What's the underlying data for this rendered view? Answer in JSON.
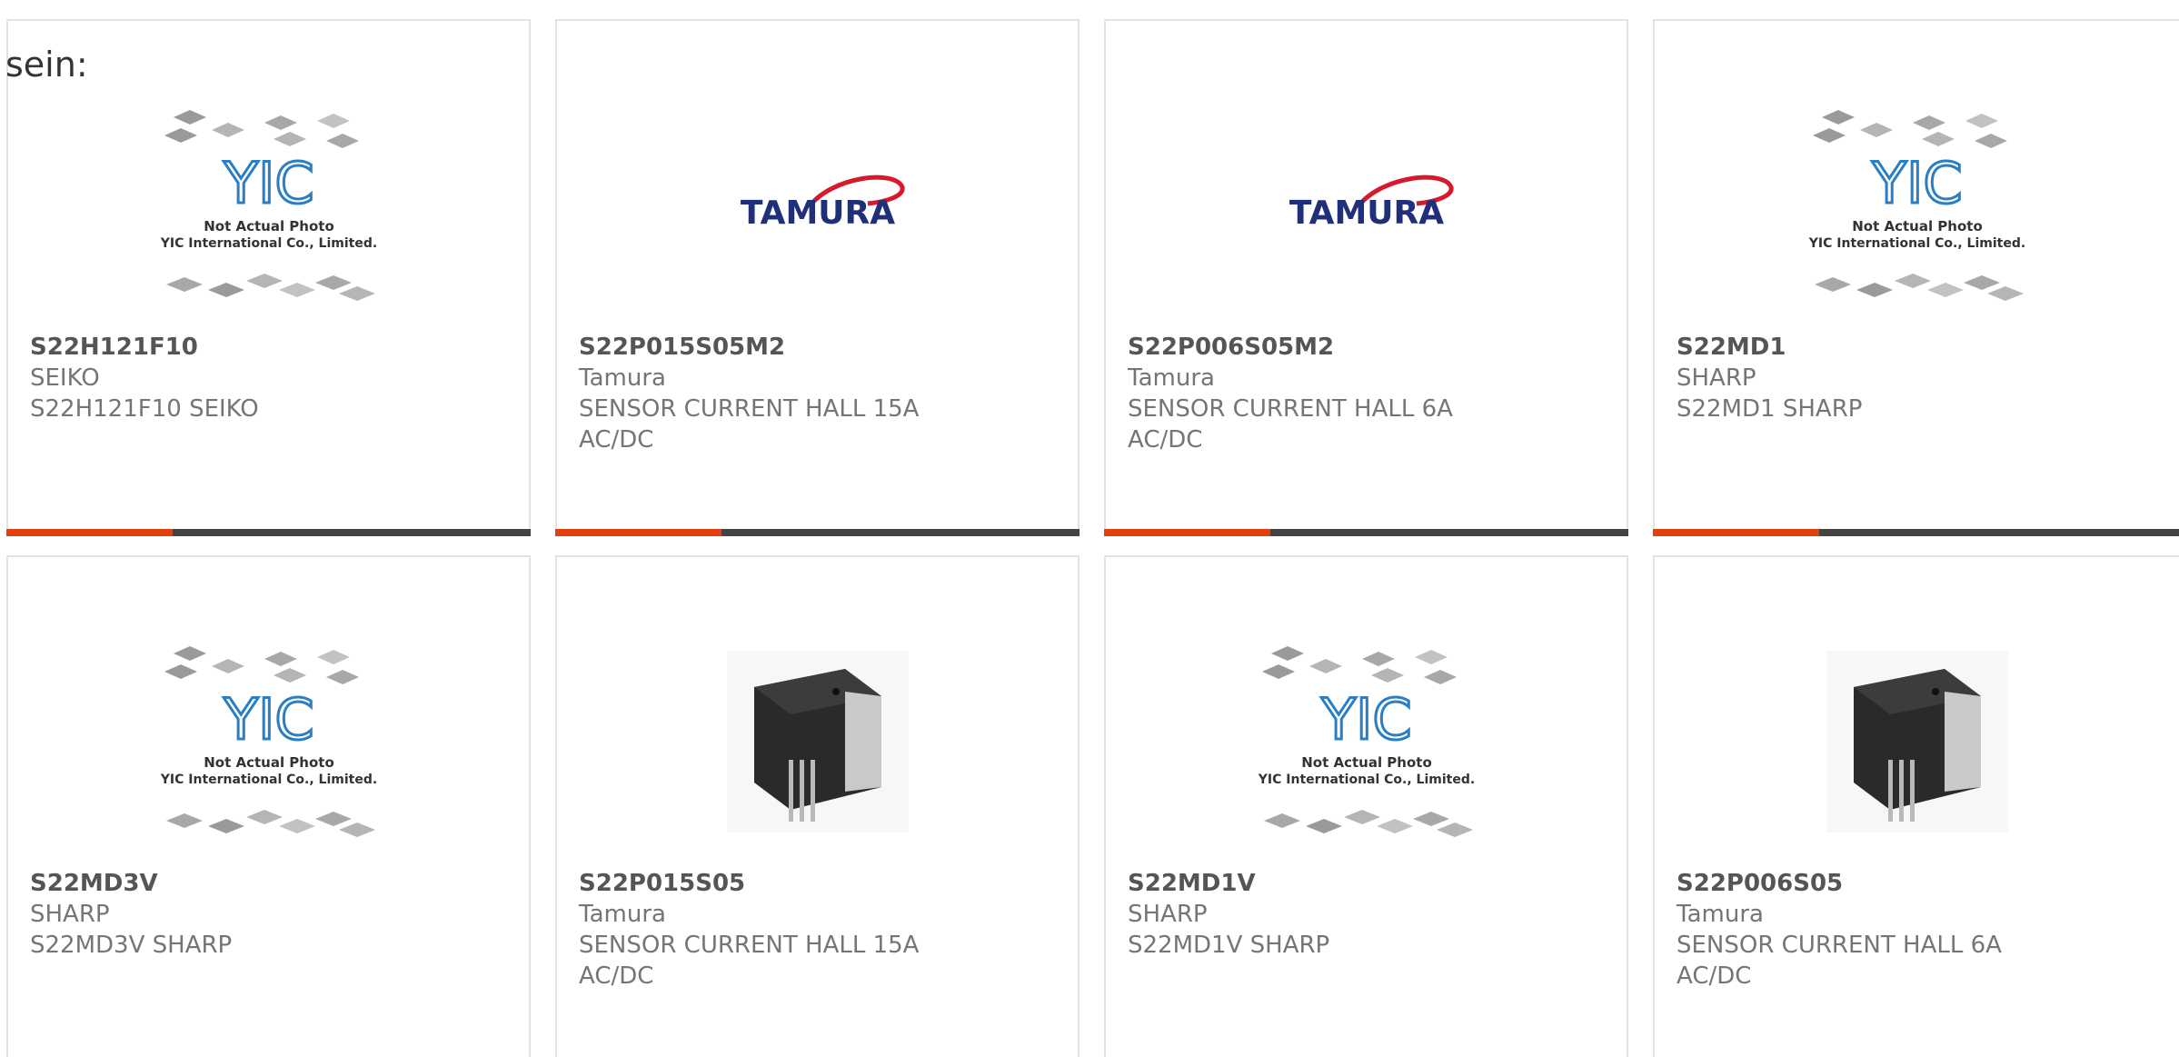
{
  "lead_text": "sein:",
  "placeholder": {
    "line1": "Not Actual Photo",
    "line2": "YIC International Co., Limited.",
    "logo_text": "YIC"
  },
  "tamura_logo_text": "TAMURA",
  "accent_color": "#e53f11",
  "bar_color": "#444444",
  "products": [
    {
      "part_number": "S22H121F10",
      "manufacturer": "SEIKO",
      "description": "S22H121F10 SEIKO",
      "image": "yic-placeholder"
    },
    {
      "part_number": "S22P015S05M2",
      "manufacturer": "Tamura",
      "description": "SENSOR CURRENT HALL 15A AC/DC",
      "image": "tamura-logo"
    },
    {
      "part_number": "S22P006S05M2",
      "manufacturer": "Tamura",
      "description": "SENSOR CURRENT HALL 6A AC/DC",
      "image": "tamura-logo"
    },
    {
      "part_number": "S22MD1",
      "manufacturer": "SHARP",
      "description": "S22MD1 SHARP",
      "image": "yic-placeholder"
    },
    {
      "part_number": "S22MD3V",
      "manufacturer": "SHARP",
      "description": "S22MD3V SHARP",
      "image": "yic-placeholder"
    },
    {
      "part_number": "S22P015S05",
      "manufacturer": "Tamura",
      "description": "SENSOR CURRENT HALL 15A AC/DC",
      "image": "sensor-photo"
    },
    {
      "part_number": "S22MD1V",
      "manufacturer": "SHARP",
      "description": "S22MD1V SHARP",
      "image": "yic-placeholder"
    },
    {
      "part_number": "S22P006S05",
      "manufacturer": "Tamura",
      "description": "SENSOR CURRENT HALL 6A AC/DC",
      "image": "sensor-photo"
    }
  ]
}
